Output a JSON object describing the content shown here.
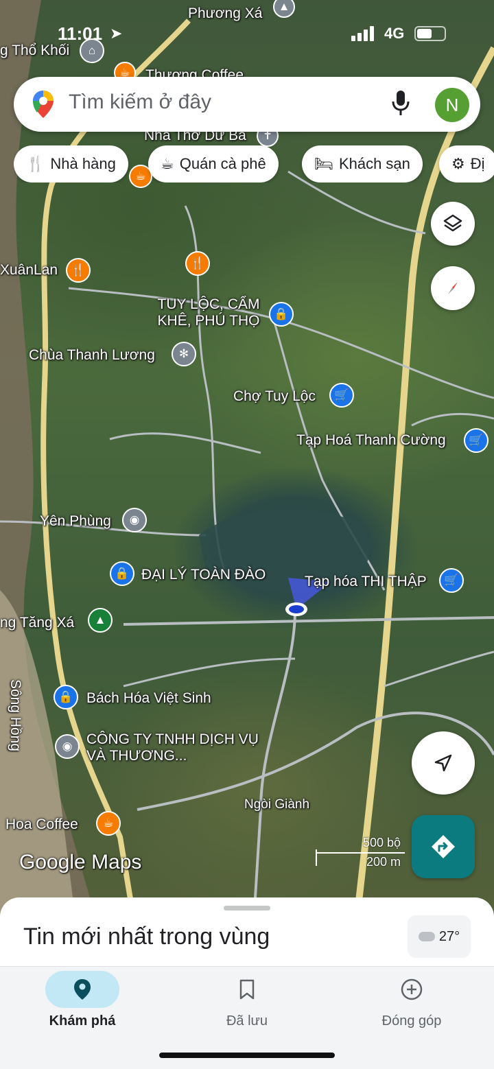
{
  "status_bar": {
    "time": "11:01",
    "network": "4G"
  },
  "search": {
    "placeholder": "Tìm kiếm ở đây",
    "avatar_initial": "N"
  },
  "chips": [
    {
      "label": "Nhà hàng",
      "icon": "fork-knife-icon"
    },
    {
      "label": "Quán cà phê",
      "icon": "coffee-cup-icon"
    },
    {
      "label": "Khách sạn",
      "icon": "bed-icon"
    },
    {
      "label": "Đị",
      "icon": "camera-icon"
    }
  ],
  "map_labels": {
    "phuong_xa": "Phương Xá",
    "tho_khoi": "g Thổ Khối",
    "thuong_coffee": "Thương Coffee",
    "nha_tho": "Nhà Thờ Dư Ba",
    "xuan_lan": "XuânLan",
    "tuy_loc": "TUY LỘC, CẨM KHÊ, PHÚ THỌ",
    "chua": "Chùa Thanh Lương",
    "cho_tuy_loc": "Chợ Tuy Lộc",
    "tap_hoa_thanh_cuong": "Tạp Hoá Thanh Cường",
    "yen_phung": "Yên Phùng",
    "dai_ly": "ĐẠI LÝ TOÀN ĐÀO",
    "tap_hoa_thi_thap": "Tạp hóa THI THẬP",
    "tang_xa": "ng Tăng Xá",
    "song_hong": "Sông Hồng",
    "bach_hoa": "Bách Hóa Việt Sinh",
    "cong_ty": "CÔNG TY TNHH DỊCH VỤ VÀ THƯƠNG...",
    "ngoi_gianh": "Ngòi Giành",
    "hoa_coffee": "Hoa Coffee"
  },
  "scale": {
    "top": "500 bộ",
    "bottom": "200 m"
  },
  "branding": "Google Maps",
  "sheet": {
    "title": "Tin mới nhất trong vùng",
    "temperature": "27°"
  },
  "nav": [
    {
      "label": "Khám phá",
      "icon": "location-pin-icon",
      "active": true
    },
    {
      "label": "Đã lưu",
      "icon": "bookmark-icon",
      "active": false
    },
    {
      "label": "Đóng góp",
      "icon": "add-circle-icon",
      "active": false
    }
  ]
}
